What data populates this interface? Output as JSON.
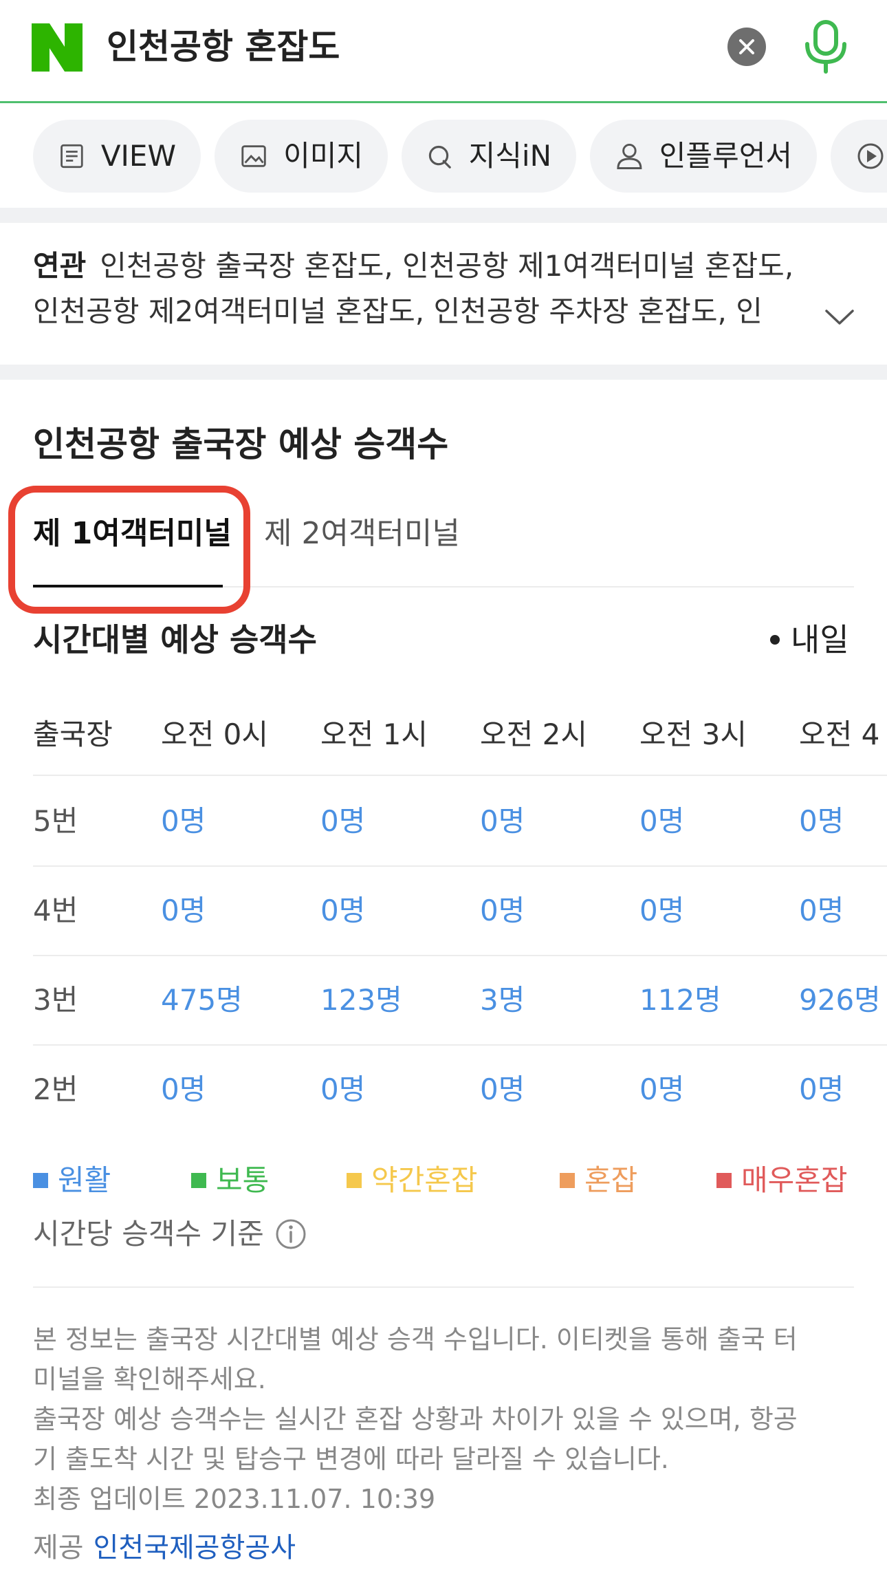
{
  "search": {
    "query": "인천공항 혼잡도"
  },
  "tabs_bar": {
    "chips": [
      {
        "label": "VIEW",
        "icon": "document-icon"
      },
      {
        "label": "이미지",
        "icon": "image-icon"
      },
      {
        "label": "지식iN",
        "icon": "q-icon"
      },
      {
        "label": "인플루언서",
        "icon": "person-icon"
      },
      {
        "label": "",
        "icon": "play-icon"
      }
    ]
  },
  "related": {
    "label": "연관",
    "line1": "인천공항 출국장 혼잡도, 인천공항 제1여객터미널 혼잡도,",
    "line2": "인천공항 제2여객터미널 혼잡도, 인천공항 주차장 혼잡도, 인"
  },
  "section": {
    "title": "인천공항 출국장 예상 승객수",
    "terminal_tabs": [
      "제 1여객터미널",
      "제 2여객터미널"
    ],
    "sub_title": "시간대별 예상 승객수",
    "day_selector": "내일"
  },
  "table": {
    "headers": [
      "출국장",
      "오전 0시",
      "오전 1시",
      "오전 2시",
      "오전 3시",
      "오전 4"
    ],
    "rows": [
      {
        "gate": "5번",
        "values": [
          "0명",
          "0명",
          "0명",
          "0명",
          "0명"
        ]
      },
      {
        "gate": "4번",
        "values": [
          "0명",
          "0명",
          "0명",
          "0명",
          "0명"
        ]
      },
      {
        "gate": "3번",
        "values": [
          "475명",
          "123명",
          "3명",
          "112명",
          "926명"
        ]
      },
      {
        "gate": "2번",
        "values": [
          "0명",
          "0명",
          "0명",
          "0명",
          "0명"
        ]
      }
    ]
  },
  "legend": [
    {
      "label": "원활",
      "color": "#4a90e2"
    },
    {
      "label": "보통",
      "color": "#3fb950"
    },
    {
      "label": "약간혼잡",
      "color": "#f5c84c"
    },
    {
      "label": "혼잡",
      "color": "#ee9d5d"
    },
    {
      "label": "매우혼잡",
      "color": "#e05a5a"
    }
  ],
  "basis_text": "시간당 승객수 기준",
  "notice": {
    "line1": "본 정보는 출국장 시간대별 예상 승객 수입니다. 이티켓을 통해 출국 터",
    "line2": "미널을 확인해주세요.",
    "line3": "출국장 예상 승객수는 실시간 혼잡 상황과 차이가 있을 수 있으며, 항공",
    "line4": "기 출도착 시간 및 탑승구 변경에 따라 달라질 수 있습니다.",
    "line5": "최종 업데이트 2023.11.07. 10:39"
  },
  "provider": {
    "label": "제공",
    "name": "인천국제공항공사"
  },
  "colors": {
    "brand_green": "#2db400",
    "accent_blue": "#4a90e2",
    "highlight_red": "#e84132",
    "link_blue": "#1f5fbf"
  }
}
